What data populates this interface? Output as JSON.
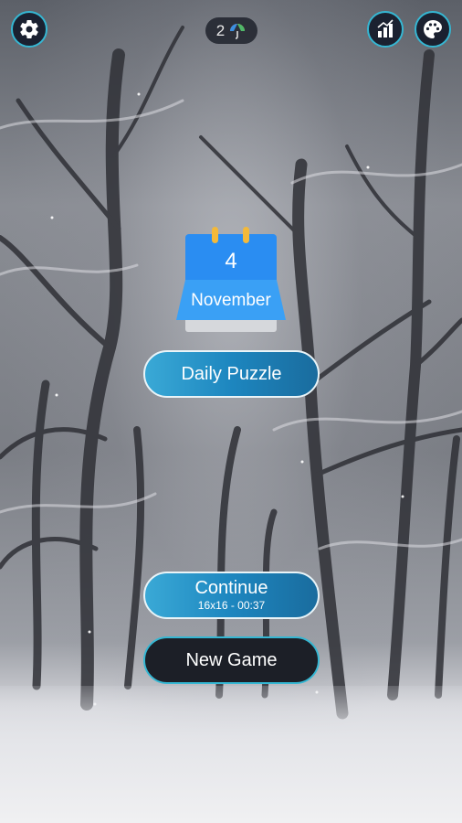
{
  "header": {
    "settings_icon": "gear-icon",
    "hints_count": "2",
    "hints_icon": "umbrella-icon",
    "stats_icon": "bar-chart-icon",
    "theme_icon": "palette-icon"
  },
  "calendar": {
    "day": "4",
    "month": "November"
  },
  "buttons": {
    "daily_puzzle": "Daily Puzzle",
    "continue": "Continue",
    "continue_detail": "16x16 - 00:37",
    "new_game": "New Game"
  },
  "colors": {
    "accent": "#35b7d3",
    "button_blue": "#1d86bf",
    "button_dark": "#1c1f27",
    "calendar_blue": "#2a8df2"
  }
}
